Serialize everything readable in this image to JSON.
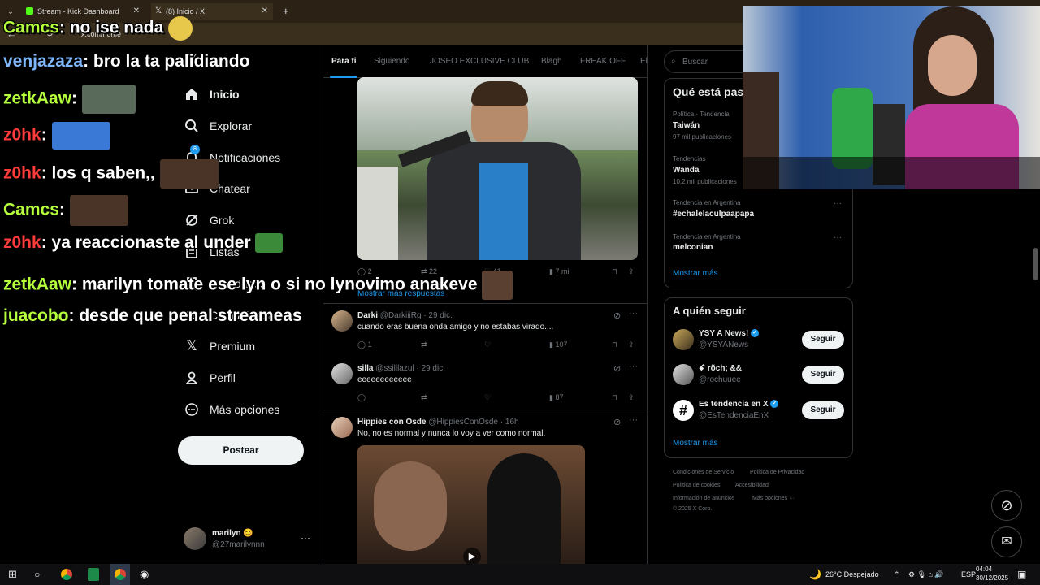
{
  "browser": {
    "tabs": [
      {
        "title": "Stream - Kick Dashboard"
      },
      {
        "title": "(8) Inicio / X"
      }
    ],
    "url": "x.com/home"
  },
  "x": {
    "nav": [
      {
        "label": "Inicio",
        "icon": "home-icon"
      },
      {
        "label": "Explorar",
        "icon": "search-icon"
      },
      {
        "label": "Notificaciones",
        "icon": "bell-icon",
        "badge": "8"
      },
      {
        "label": "Chatear",
        "icon": "mail-icon"
      },
      {
        "label": "Grok",
        "icon": "grok-icon"
      },
      {
        "label": "Listas",
        "icon": "list-icon"
      },
      {
        "label": "Guardados",
        "icon": "bookmark-icon"
      },
      {
        "label": "Comunidades",
        "icon": "people-icon"
      },
      {
        "label": "Premium",
        "icon": "x-logo-icon"
      },
      {
        "label": "Perfil",
        "icon": "person-icon"
      },
      {
        "label": "Más opciones",
        "icon": "more-circle-icon"
      }
    ],
    "post_button": "Postear",
    "account": {
      "name": "marilyn 😊",
      "handle": "@27marilynnn"
    },
    "feed_tabs": [
      "Para ti",
      "Siguiendo",
      "JOSEO EXCLUSIVE CLUB",
      "Blagh",
      "FREAK OFF",
      "El"
    ],
    "first_post_actions": {
      "replies": "2",
      "reposts": "22",
      "likes": "41",
      "views": "7 mil"
    },
    "show_more_replies": "Mostrar más respuestas",
    "replies": [
      {
        "name": "Darki",
        "handle": "@DarkiiiRg",
        "date": "29 dic.",
        "text": "cuando eras buena onda amigo y no estabas virado....",
        "replies": "1",
        "views": "107"
      },
      {
        "name": "silla",
        "handle": "@ssilllazul",
        "date": "29 dic.",
        "text": "eeeeeeeeeeee",
        "replies": "",
        "views": "87"
      }
    ],
    "post": {
      "name": "Hippies con Osde",
      "handle": "@HippiesConOsde",
      "date": "16h",
      "text": "No, no es normal y nunca lo voy a ver como normal."
    },
    "search_placeholder": "Buscar",
    "trends_title": "Qué está pas",
    "trends": [
      {
        "context": "Política · Tendencia",
        "name": "Taiwán",
        "count": "97 mil publicaciones"
      },
      {
        "context": "Tendencias",
        "name": "Wanda",
        "count": "10,2 mil publicaciones"
      },
      {
        "context": "Tendencia en Argentina",
        "name": "#echalelaculpaapapa",
        "count": ""
      },
      {
        "context": "Tendencia en Argentina",
        "name": "melconian",
        "count": ""
      }
    ],
    "show_more": "Mostrar más",
    "who_to_follow_title": "A quién seguir",
    "follow": [
      {
        "name": "YSY A News!",
        "handle": "@YSYANews",
        "verified": true
      },
      {
        "name": "ꗃ rõch; &&",
        "handle": "@rochuuee",
        "verified": false
      },
      {
        "name": "Es tendencia en X",
        "handle": "@EsTendenciaEnX",
        "verified": true
      }
    ],
    "follow_button": "Seguir",
    "footer": [
      "Condiciones de Servicio",
      "Política de Privacidad",
      "Política de cookies",
      "Accesibilidad",
      "Información de anuncios",
      "Más opciones ···",
      "© 2025 X Corp."
    ]
  },
  "chat": [
    {
      "user": "Camcs",
      "color": "#b6ff3b",
      "message": "no ise nada"
    },
    {
      "user": "venjazaza",
      "color": "#7fb7ff",
      "message": "bro la ta palidiando"
    },
    {
      "user": "zetkAaw",
      "color": "#b6ff3b",
      "message": ""
    },
    {
      "user": "z0hk",
      "color": "#ff3b3b",
      "message": ""
    },
    {
      "user": "z0hk",
      "color": "#ff3b3b",
      "message": "los q saben,,"
    },
    {
      "user": "Camcs",
      "color": "#b6ff3b",
      "message": ""
    },
    {
      "user": "z0hk",
      "color": "#ff3b3b",
      "message": "ya reaccionaste al under"
    },
    {
      "user": "zetkAaw",
      "color": "#b6ff3b",
      "message": "marilyn tomate ese lyn o si no lynovimo anakeve"
    },
    {
      "user": "juacobo",
      "color": "#b6ff3b",
      "message": "desde que penal streameas"
    }
  ],
  "taskbar": {
    "weather": "26°C Despejado",
    "lang": "ESP",
    "time": "04:04",
    "date": "30/12/2025"
  },
  "colors": {
    "accent": "#1d9bf0",
    "background": "#000000",
    "border": "#2f3336"
  }
}
